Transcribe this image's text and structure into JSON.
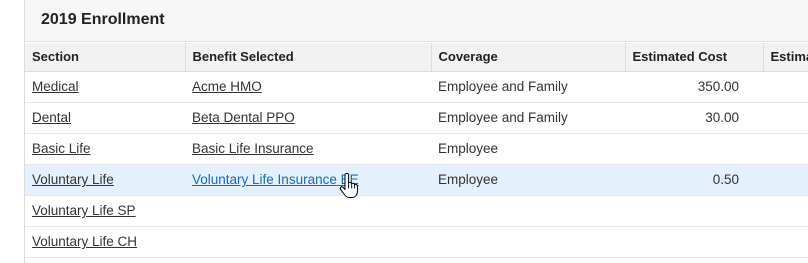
{
  "panel": {
    "title": "2019 Enrollment"
  },
  "table": {
    "columns": [
      "Section",
      "Benefit Selected",
      "Coverage",
      "Estimated Cost",
      "Estima"
    ],
    "rows": [
      {
        "section": "Medical",
        "benefit": "Acme HMO",
        "coverage": "Employee and Family",
        "cost": "350.00",
        "extra": ""
      },
      {
        "section": "Dental",
        "benefit": "Beta Dental PPO",
        "coverage": "Employee and Family",
        "cost": "30.00",
        "extra": ""
      },
      {
        "section": "Basic Life",
        "benefit": "Basic Life Insurance",
        "coverage": "Employee",
        "cost": "",
        "extra": ""
      },
      {
        "section": "Voluntary Life",
        "benefit": "Voluntary Life Insurance EE",
        "coverage": "Employee",
        "cost": "0.50",
        "extra": ""
      },
      {
        "section": "Voluntary Life SP",
        "benefit": "",
        "coverage": "",
        "cost": "",
        "extra": ""
      },
      {
        "section": "Voluntary Life CH",
        "benefit": "",
        "coverage": "",
        "cost": "",
        "extra": ""
      }
    ],
    "highlighted_row": 3
  },
  "colors": {
    "header_bg": "#f7f7f7",
    "row_highlight": "#e4f0fb",
    "link_hover": "#1a6ab3"
  },
  "cursor": {
    "icon": "hand-pointer-icon"
  }
}
